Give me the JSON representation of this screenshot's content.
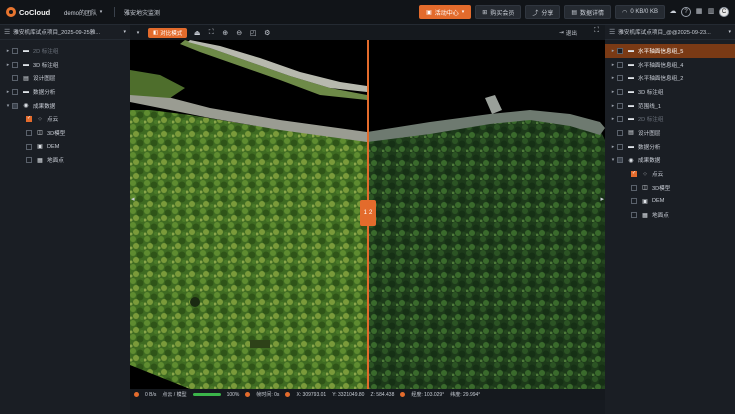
{
  "app": {
    "name": "CoCloud"
  },
  "header": {
    "team": "demo的团队",
    "project": "雅安地灾监测",
    "activity_label": "活动中心",
    "buy_label": "购买会员",
    "share_label": "分享",
    "details_label": "数据详情",
    "speed": "0 KB/0 KB"
  },
  "left_panel": {
    "title": "雅安机库试点项目_2025-09-25雅...",
    "items": [
      {
        "label": "2D 标注组",
        "caret": "▸",
        "checked": "off",
        "icon": "folder-icon",
        "glyph": "▬",
        "dim": true,
        "indent": 0
      },
      {
        "label": "3D 标注组",
        "caret": "▸",
        "checked": "off",
        "icon": "folder-icon",
        "glyph": "▬",
        "dim": false,
        "indent": 0
      },
      {
        "label": "设计图层",
        "caret": "",
        "checked": "off",
        "icon": "layer-icon",
        "glyph": "▤",
        "dim": false,
        "indent": 0
      },
      {
        "label": "数据分析",
        "caret": "▸",
        "checked": "off",
        "icon": "folder-icon",
        "glyph": "▬",
        "dim": false,
        "indent": 0
      },
      {
        "label": "成果数据",
        "caret": "▾",
        "checked": "half",
        "icon": "globe-icon",
        "glyph": "◉",
        "dim": false,
        "indent": 0
      },
      {
        "label": "点云",
        "caret": "",
        "checked": "on",
        "icon": "pointcloud-icon",
        "glyph": "⁘",
        "dim": false,
        "indent": 1
      },
      {
        "label": "3D模型",
        "caret": "",
        "checked": "off",
        "icon": "cube-icon",
        "glyph": "◫",
        "dim": false,
        "indent": 1
      },
      {
        "label": "DEM",
        "caret": "",
        "checked": "off",
        "icon": "dem-icon",
        "glyph": "▣",
        "dim": false,
        "indent": 1
      },
      {
        "label": "地面点",
        "caret": "",
        "checked": "off",
        "icon": "ground-icon",
        "glyph": "▦",
        "dim": false,
        "indent": 1
      }
    ]
  },
  "right_panel": {
    "title": "雅安机库试点项目_@@2025-09-23...",
    "items": [
      {
        "label": "水平轴面信息组_5",
        "caret": "▸",
        "checked": "off",
        "icon": "folder-icon",
        "glyph": "▬",
        "dim": false,
        "sel": true,
        "indent": 0
      },
      {
        "label": "水平轴面信息组_4",
        "caret": "▸",
        "checked": "off",
        "icon": "folder-icon",
        "glyph": "▬",
        "dim": false,
        "sel": false,
        "indent": 0
      },
      {
        "label": "水平轴面信息组_2",
        "caret": "▸",
        "checked": "off",
        "icon": "folder-icon",
        "glyph": "▬",
        "dim": false,
        "sel": false,
        "indent": 0
      },
      {
        "label": "3D 标注组",
        "caret": "▸",
        "checked": "off",
        "icon": "folder-icon",
        "glyph": "▬",
        "dim": false,
        "sel": false,
        "indent": 0
      },
      {
        "label": "范围线_1",
        "caret": "▸",
        "checked": "off",
        "icon": "folder-icon",
        "glyph": "▬",
        "dim": false,
        "sel": false,
        "indent": 0
      },
      {
        "label": "2D 标注组",
        "caret": "▸",
        "checked": "off",
        "icon": "folder-icon",
        "glyph": "▬",
        "dim": true,
        "sel": false,
        "indent": 0
      },
      {
        "label": "设计图层",
        "caret": "",
        "checked": "off",
        "icon": "layer-icon",
        "glyph": "▤",
        "dim": false,
        "sel": false,
        "indent": 0
      },
      {
        "label": "数据分析",
        "caret": "▸",
        "checked": "off",
        "icon": "folder-icon",
        "glyph": "▬",
        "dim": false,
        "sel": false,
        "indent": 0
      },
      {
        "label": "成果数据",
        "caret": "▾",
        "checked": "half",
        "icon": "globe-icon",
        "glyph": "◉",
        "dim": false,
        "sel": false,
        "indent": 0
      },
      {
        "label": "点云",
        "caret": "",
        "checked": "on",
        "icon": "pointcloud-icon",
        "glyph": "⁘",
        "dim": false,
        "sel": false,
        "indent": 1
      },
      {
        "label": "3D模型",
        "caret": "",
        "checked": "off",
        "icon": "cube-icon",
        "glyph": "◫",
        "dim": false,
        "sel": false,
        "indent": 1
      },
      {
        "label": "DEM",
        "caret": "",
        "checked": "off",
        "icon": "dem-icon",
        "glyph": "▣",
        "dim": false,
        "sel": false,
        "indent": 1
      },
      {
        "label": "地面点",
        "caret": "",
        "checked": "off",
        "icon": "ground-icon",
        "glyph": "▦",
        "dim": false,
        "sel": false,
        "indent": 1
      }
    ]
  },
  "viewport": {
    "compare_label": "对比模式",
    "exit_label": "退出",
    "split_left": "1",
    "split_right": "2"
  },
  "status": {
    "net": "0 B/s",
    "mode": "点云 / 模型",
    "progress_text": "100%",
    "progress": 1.0,
    "time": "帧时间: 0s",
    "x": "X: 309793.01",
    "y": "Y: 3321049.80",
    "z": "Z: 584.438",
    "lon": "经度: 103.029°",
    "lat": "纬度: 29.994°"
  },
  "colors": {
    "accent": "#e36b2c",
    "panel": "#1a1e24",
    "topbar": "#111418",
    "progress": "#3bb54a"
  }
}
